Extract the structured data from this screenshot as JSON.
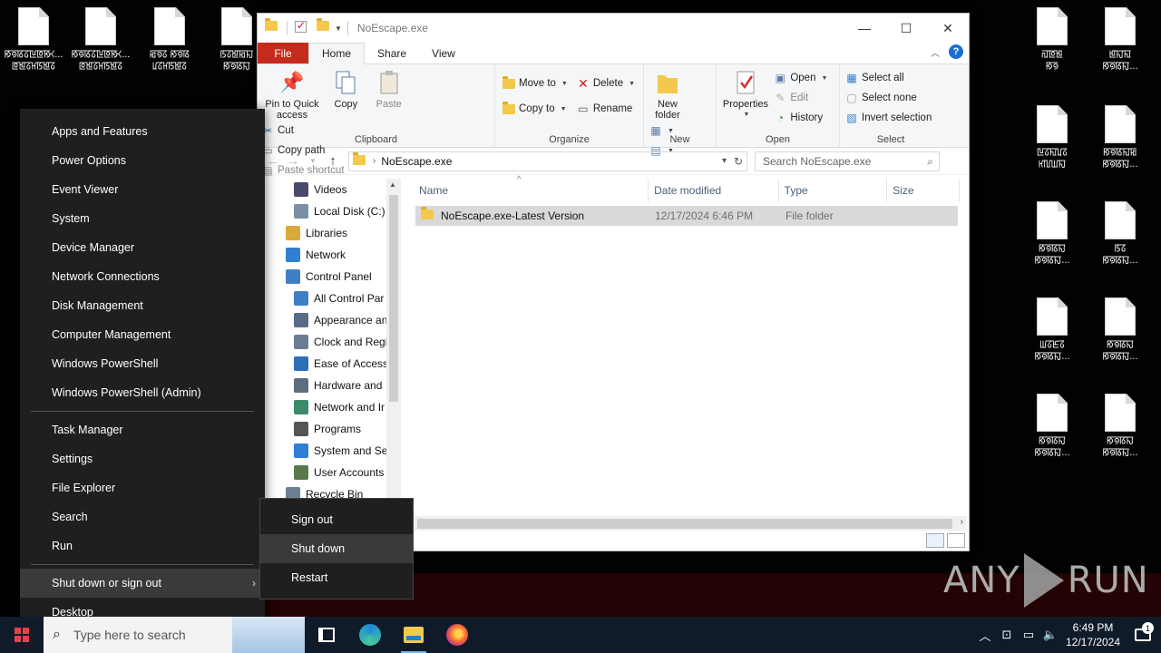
{
  "desktop": {
    "icons": [
      {
        "label": "ꡐꡟꡋꡞꡖꡔꡐꡡ...",
        "l2": "ꡔꡁꡞꡘꡑꡁꡞ"
      },
      {
        "label": "ꡐꡟꡋꡞꡖꡔꡐꡡ...",
        "l2": "ꡔꡁꡞꡘꡑꡁꡞ"
      },
      {
        "label": "ꡂꡟꡞ ꡐꡟꡋ",
        "l2": "ꡊꡞꡘꡑꡁꡞ"
      },
      {
        "label": "ꡑꡞꡁꡂꡍ",
        "l2": "ꡐꡟꡋꡍ"
      },
      {
        "label": "ꡌꡔꡁ",
        "l2": "ꡐꡟ"
      },
      {
        "label": "ꡁꡍꡎ",
        "l2": "ꡐꡟꡋꡍ..."
      },
      {
        "label": "ꡖꡞꡎꡊꡞ",
        "l2": "ꡘꡃꡆꡍ"
      },
      {
        "label": "ꡐꡟꡋꡎꡂ",
        "l2": "ꡐꡟꡋꡍ..."
      },
      {
        "label": "ꡐꡟꡋꡍ",
        "l2": "ꡐꡟꡋꡍ..."
      },
      {
        "label": "ꡑꡞ",
        "l2": "ꡐꡟꡋꡍ..."
      },
      {
        "label": "ꡆꡞꡈꡞ",
        "l2": "ꡐꡟꡋꡍ..."
      },
      {
        "label": "ꡐꡟꡋꡍ",
        "l2": "ꡐꡟꡋꡍ..."
      },
      {
        "label": "ꡐꡟꡋꡍ",
        "l2": "ꡐꡟꡋꡍ..."
      },
      {
        "label": "ꡐꡟꡋꡍ",
        "l2": "ꡐꡟꡋꡍ..."
      }
    ]
  },
  "explorer": {
    "title": "NoEscape.exe",
    "tabs": [
      "File",
      "Home",
      "Share",
      "View"
    ],
    "active_tab": "Home",
    "ribbon": {
      "clipboard": {
        "label": "Clipboard",
        "pin": "Pin to Quick access",
        "copy": "Copy",
        "paste": "Paste",
        "cut": "Cut",
        "copy_path": "Copy path",
        "paste_shortcut": "Paste shortcut"
      },
      "organize": {
        "label": "Organize",
        "move_to": "Move to",
        "copy_to": "Copy to",
        "delete": "Delete",
        "rename": "Rename"
      },
      "new": {
        "label": "New",
        "new_folder": "New folder"
      },
      "open": {
        "label": "Open",
        "properties": "Properties",
        "open": "Open",
        "edit": "Edit",
        "history": "History"
      },
      "select": {
        "label": "Select",
        "select_all": "Select all",
        "select_none": "Select none",
        "invert": "Invert selection"
      }
    },
    "address": "NoEscape.exe",
    "search_placeholder": "Search NoEscape.exe",
    "nav": [
      {
        "label": "Videos",
        "level": 2,
        "color": "#4a4a6a"
      },
      {
        "label": "Local Disk (C:)",
        "level": 2,
        "color": "#7a8fa5"
      },
      {
        "label": "Libraries",
        "level": 1,
        "color": "#d9a93a"
      },
      {
        "label": "Network",
        "level": 1,
        "color": "#2f7fd3"
      },
      {
        "label": "Control Panel",
        "level": 1,
        "color": "#3f7fc6"
      },
      {
        "label": "All Control Par",
        "level": 2,
        "color": "#3f7fc6"
      },
      {
        "label": "Appearance an",
        "level": 2,
        "color": "#5a6b8a"
      },
      {
        "label": "Clock and Regi",
        "level": 2,
        "color": "#6a7d93"
      },
      {
        "label": "Ease of Access",
        "level": 2,
        "color": "#2f6fb8"
      },
      {
        "label": "Hardware and",
        "level": 2,
        "color": "#5a6e80"
      },
      {
        "label": "Network and Ir",
        "level": 2,
        "color": "#3b8a6a"
      },
      {
        "label": "Programs",
        "level": 2,
        "color": "#555"
      },
      {
        "label": "System and Sec",
        "level": 2,
        "color": "#2f7fd3"
      },
      {
        "label": "User Accounts",
        "level": 2,
        "color": "#5a7a4a"
      },
      {
        "label": "Recycle Bin",
        "level": 1,
        "color": "#6d7f93"
      }
    ],
    "columns": [
      "Name",
      "Date modified",
      "Type",
      "Size"
    ],
    "files": [
      {
        "name": "NoEscape.exe-Latest Version",
        "date": "12/17/2024 6:46 PM",
        "type": "File folder",
        "size": ""
      }
    ]
  },
  "winx_menu": {
    "group1": [
      "Apps and Features",
      "Power Options",
      "Event Viewer",
      "System",
      "Device Manager",
      "Network Connections",
      "Disk Management",
      "Computer Management",
      "Windows PowerShell",
      "Windows PowerShell (Admin)"
    ],
    "group2": [
      "Task Manager",
      "Settings",
      "File Explorer",
      "Search",
      "Run"
    ],
    "shutdown": "Shut down or sign out",
    "desktop": "Desktop"
  },
  "submenu": {
    "items": [
      "Sign out",
      "Shut down",
      "Restart"
    ],
    "highlighted": "Shut down"
  },
  "watermark": {
    "left": "ANY",
    "right": "RUN"
  },
  "taskbar": {
    "search_placeholder": "Type here to search",
    "time": "6:49 PM",
    "date": "12/17/2024",
    "notification_count": "1"
  }
}
